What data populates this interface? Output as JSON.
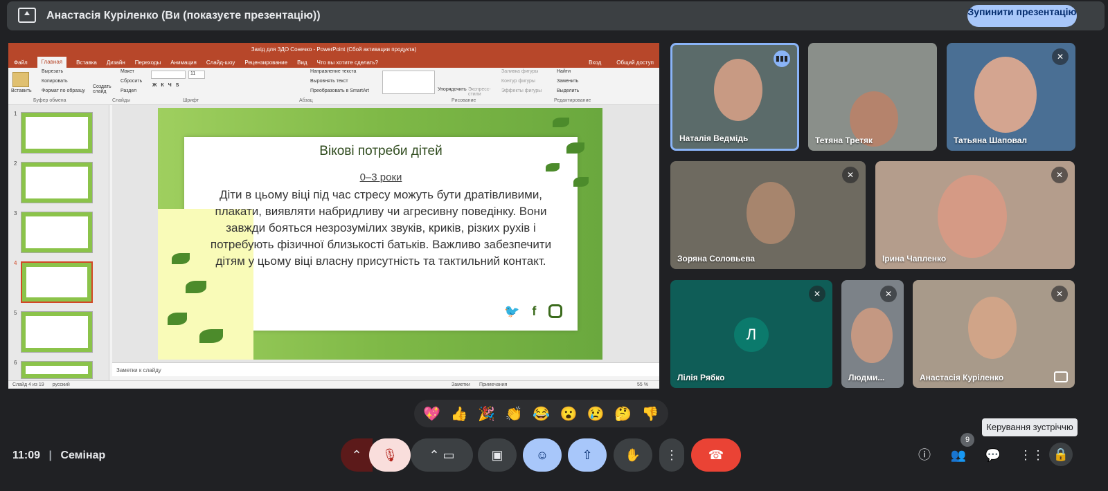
{
  "presenting": {
    "title": "Анастасія Куріленко (Ви (показуєте презентацію))",
    "stop_label": "Зупинити презентацію"
  },
  "ppt": {
    "window_title": "Захід для ЗДО Сонечко - PowerPoint (Сбой активации продукта)",
    "tabs": [
      "Файл",
      "Главная",
      "Вставка",
      "Дизайн",
      "Переходы",
      "Анимация",
      "Слайд-шоу",
      "Рецензирование",
      "Вид",
      "Что вы хотите сделать?"
    ],
    "account": [
      "Вход",
      "Общий доступ"
    ],
    "ribbon": {
      "clipboard": [
        "Вставить",
        "Вырезать",
        "Копировать",
        "Формат по образцу"
      ],
      "clipboard_label": "Буфер обмена",
      "slides": [
        "Создать слайд",
        "Макет",
        "Сбросить",
        "Раздел"
      ],
      "slides_label": "Слайды",
      "font_label": "Шрифт",
      "font_size": "11",
      "paragraph": [
        "Направление текста",
        "Выровнять текст",
        "Преобразовать в SmartArt"
      ],
      "paragraph_label": "Абзац",
      "drawing": [
        "Упорядочить",
        "Экспресс-стили",
        "Заливка фигуры",
        "Контур фигуры",
        "Эффекты фигуры"
      ],
      "drawing_label": "Рисование",
      "editing": [
        "Найти",
        "Заменить",
        "Выделить"
      ],
      "editing_label": "Редактирование"
    },
    "thumbnails": [
      "1",
      "2",
      "3",
      "4",
      "5",
      "6"
    ],
    "slide": {
      "heading": "Вікові потреби дітей",
      "subheading": "0–3 роки",
      "body": "Діти в цьому віці під час стресу можуть бути дратівливими, плакати, виявляти набридливу чи агресивну поведінку. Вони завжди бояться незрозумілих звуків, криків, різких рухів і потребують фізичної близькості батьків. Важливо забезпечити дітям у цьому віці власну присутність та тактильний контакт.",
      "social_icons": [
        "twitter-icon",
        "facebook-icon",
        "instagram-icon"
      ]
    },
    "notes_placeholder": "Заметки к слайду",
    "status": {
      "slide": "Слайд 4 из 19",
      "language": "русский",
      "notes": "Заметки",
      "comments": "Примечания",
      "zoom": "55 %"
    }
  },
  "participants": [
    {
      "name": "Наталія Ведмідь",
      "state": "speaking"
    },
    {
      "name": "Тетяна Третяк",
      "state": "unmuted"
    },
    {
      "name": "Татьяна Шаповал",
      "state": "muted"
    },
    {
      "name": "Зоряна Соловьева",
      "state": "muted"
    },
    {
      "name": "Ірина Чапленко",
      "state": "muted"
    },
    {
      "name": "Лілія Рябко",
      "state": "muted",
      "initial": "Л"
    },
    {
      "name": "Людми...",
      "state": "muted"
    },
    {
      "name": "Анастасія Куріленко",
      "state": "muted"
    }
  ],
  "reactions": [
    "💖",
    "👍",
    "🎉",
    "👏",
    "😂",
    "😮",
    "😢",
    "🤔",
    "👎"
  ],
  "bottom": {
    "time": "11:09",
    "meeting": "Семінар",
    "tooltip": "Керування зустріччю",
    "people_count": "9"
  },
  "colors": {
    "accent": "#a8c7fa",
    "end_call": "#ea4335",
    "mic_off_bg": "#f9dedc",
    "ppt_brand": "#b7472a"
  }
}
